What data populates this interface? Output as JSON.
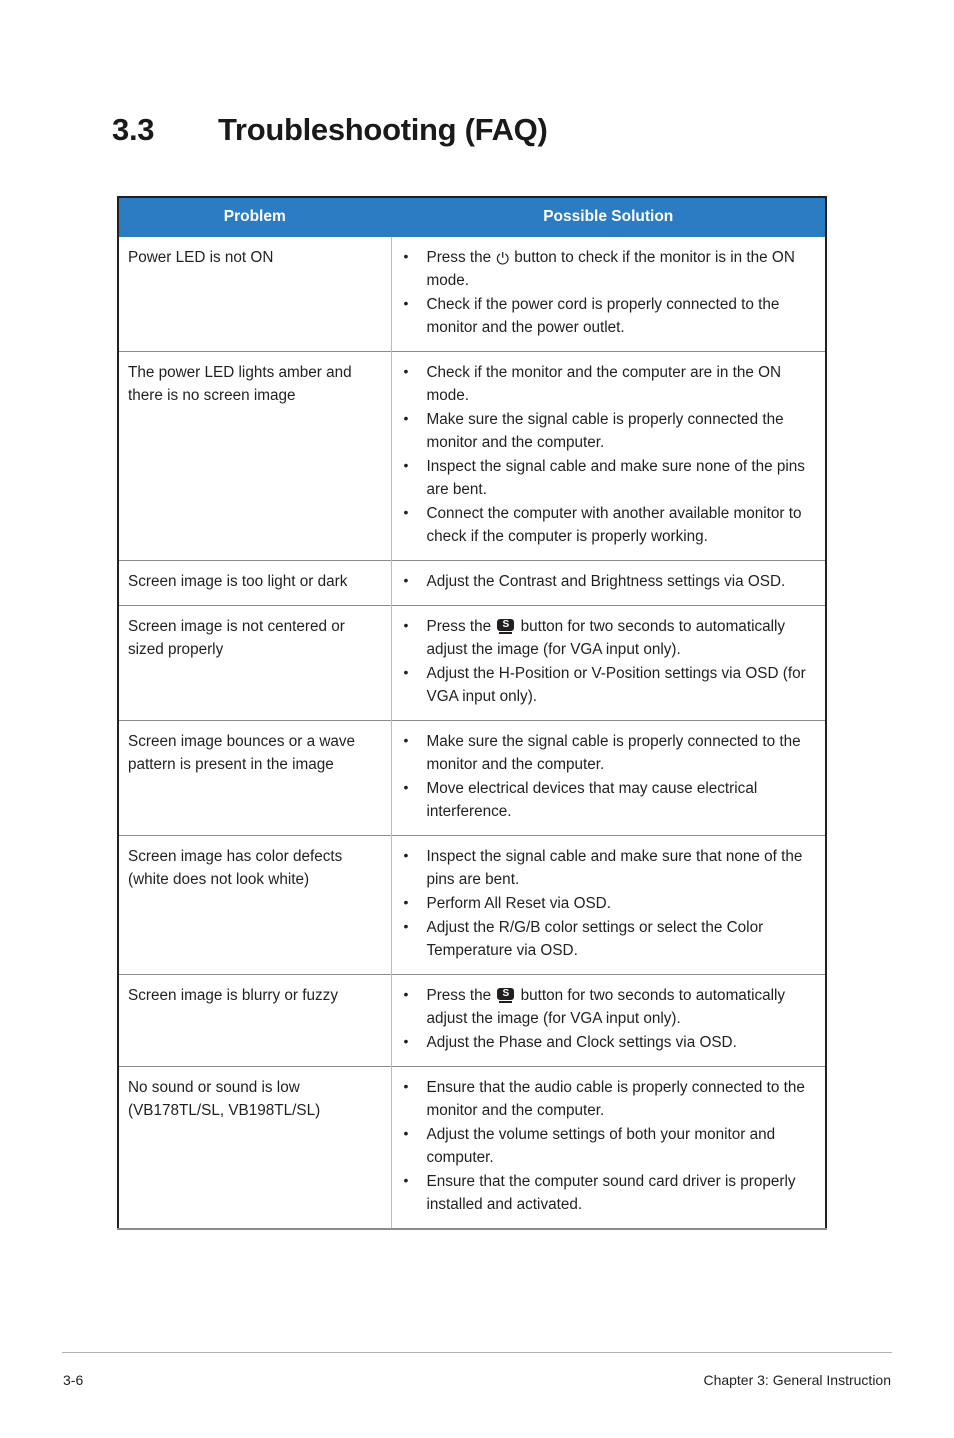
{
  "heading": {
    "number": "3.3",
    "title": "Troubleshooting (FAQ)"
  },
  "table": {
    "columns": {
      "problem": "Problem",
      "solution": "Possible Solution"
    },
    "header_bg": "#2C7CC4",
    "rows": [
      {
        "problem": "Power  LED is not ON",
        "solutions": [
          {
            "parts": [
              {
                "type": "text",
                "value": "Press the "
              },
              {
                "type": "icon",
                "icon": "power-button-icon",
                "value": "⏻"
              },
              {
                "type": "text",
                "value": " button to check if the monitor is in the ON mode."
              }
            ]
          },
          {
            "parts": [
              {
                "type": "text",
                "value": "Check if the power cord is properly connected to the monitor and the power outlet."
              }
            ]
          }
        ]
      },
      {
        "problem": "The power LED lights amber and there is no screen image",
        "solutions": [
          {
            "parts": [
              {
                "type": "text",
                "value": "Check if the monitor and the computer are in the ON mode."
              }
            ]
          },
          {
            "parts": [
              {
                "type": "text",
                "value": "Make sure the signal cable is properly connected the monitor and the computer."
              }
            ]
          },
          {
            "parts": [
              {
                "type": "text",
                "value": "Inspect the signal cable and make sure none of the pins are bent."
              }
            ]
          },
          {
            "parts": [
              {
                "type": "text",
                "value": "Connect the computer with another available monitor to check if the computer is properly working."
              }
            ]
          }
        ]
      },
      {
        "problem": "Screen image is too light or dark",
        "solutions": [
          {
            "parts": [
              {
                "type": "text",
                "value": "Adjust the Contrast and Brightness settings via OSD."
              }
            ]
          }
        ]
      },
      {
        "problem": "Screen image is not centered or sized properly",
        "solutions": [
          {
            "parts": [
              {
                "type": "text",
                "value": "Press the "
              },
              {
                "type": "icon",
                "icon": "s-button-icon",
                "value": "S"
              },
              {
                "type": "text",
                "value": " button for two seconds to automatically adjust the image (for VGA input only)."
              }
            ]
          },
          {
            "parts": [
              {
                "type": "text",
                "value": "Adjust the H-Position or V-Position settings via OSD (for VGA input only)."
              }
            ]
          }
        ]
      },
      {
        "problem": "Screen image bounces or a wave pattern is present in the image",
        "solutions": [
          {
            "parts": [
              {
                "type": "text",
                "value": "Make sure the signal cable is properly connected to the monitor and the computer."
              }
            ]
          },
          {
            "parts": [
              {
                "type": "text",
                "value": "Move electrical devices that may cause electrical interference."
              }
            ]
          }
        ]
      },
      {
        "problem": "Screen image has color defects (white does not look white)",
        "solutions": [
          {
            "parts": [
              {
                "type": "text",
                "value": "Inspect the signal cable and make sure that none of the pins are bent."
              }
            ]
          },
          {
            "parts": [
              {
                "type": "text",
                "value": "Perform All Reset via OSD."
              }
            ]
          },
          {
            "parts": [
              {
                "type": "text",
                "value": "Adjust the R/G/B color settings or select the Color Temperature via OSD."
              }
            ]
          }
        ]
      },
      {
        "problem": "Screen image is blurry or fuzzy",
        "solutions": [
          {
            "parts": [
              {
                "type": "text",
                "value": "Press the "
              },
              {
                "type": "icon",
                "icon": "s-button-icon",
                "value": "S"
              },
              {
                "type": "text",
                "value": " button for two seconds to automatically adjust the image  (for VGA input only)."
              }
            ]
          },
          {
            "parts": [
              {
                "type": "text",
                "value": "Adjust the Phase and Clock settings via OSD."
              }
            ]
          }
        ]
      },
      {
        "problem": "No sound or sound is low (VB178TL/SL, VB198TL/SL)",
        "solutions": [
          {
            "parts": [
              {
                "type": "text",
                "value": "Ensure that the audio cable is properly connected to the monitor and the computer."
              }
            ]
          },
          {
            "parts": [
              {
                "type": "text",
                "value": "Adjust the volume settings of both your monitor and computer."
              }
            ]
          },
          {
            "parts": [
              {
                "type": "text",
                "value": "Ensure that the computer sound card driver is properly installed and activated."
              }
            ]
          }
        ]
      }
    ]
  },
  "footer": {
    "page_number": "3-6",
    "chapter": "Chapter 3: General Instruction"
  }
}
